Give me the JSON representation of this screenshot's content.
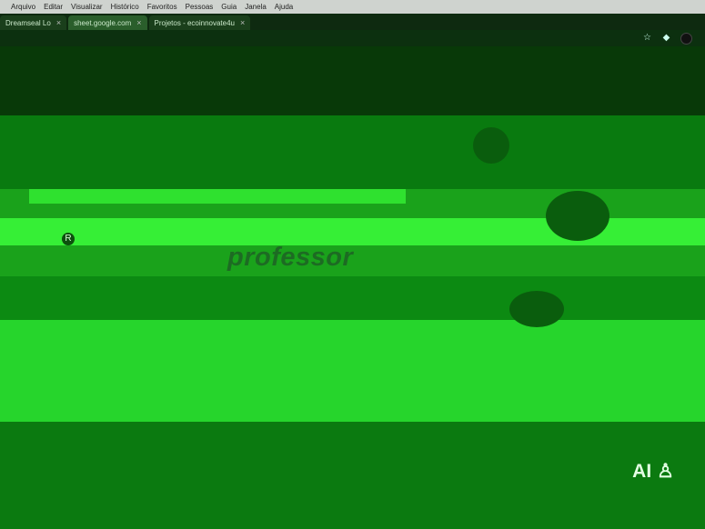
{
  "menubar": {
    "apple": "",
    "items": [
      "Arquivo",
      "Editar",
      "Visualizar",
      "Histórico",
      "Favoritos",
      "Pessoas",
      "Guia",
      "Janela",
      "Ajuda"
    ]
  },
  "tabs": [
    {
      "label": "Dreamseal Lo",
      "active": false
    },
    {
      "label": "sheet.google.com",
      "active": true
    },
    {
      "label": "Projetos - ecoinnovate4u",
      "active": false
    }
  ],
  "content": {
    "headline": "professor",
    "badge": "R",
    "footer_brand": "AI"
  },
  "colors": {
    "menubar": "#cfd3cf",
    "tabbar": "#0e2a10",
    "page": "#26d52c",
    "accent": "#1d6b23"
  }
}
